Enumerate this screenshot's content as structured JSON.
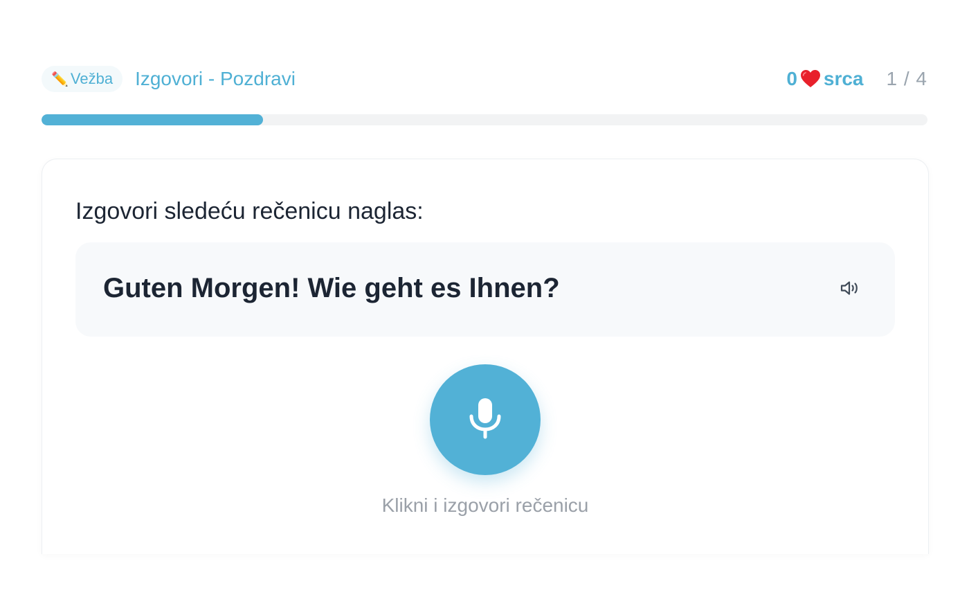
{
  "header": {
    "badge_icon": "pencil-icon",
    "badge_label": "Vežba",
    "lesson_title": "Izgovori - Pozdravi",
    "hearts_count": "0",
    "hearts_icon": "heart-icon",
    "hearts_label": "srca",
    "counter": "1 / 4"
  },
  "progress": {
    "fraction": 0.25,
    "fill_color": "#52b1d6",
    "track_color": "#f2f3f4"
  },
  "exercise": {
    "instruction": "Izgovori sledeću rečenicu naglas:",
    "sentence": "Guten Morgen! Wie geht es Ihnen?",
    "speaker_icon": "speaker-icon",
    "mic_icon": "microphone-icon",
    "mic_hint": "Klikni i izgovori rečenicu"
  },
  "colors": {
    "accent": "#52b1d6",
    "heart": "#e8202b",
    "text_dark": "#1c2533",
    "muted": "#9aa0a8"
  }
}
